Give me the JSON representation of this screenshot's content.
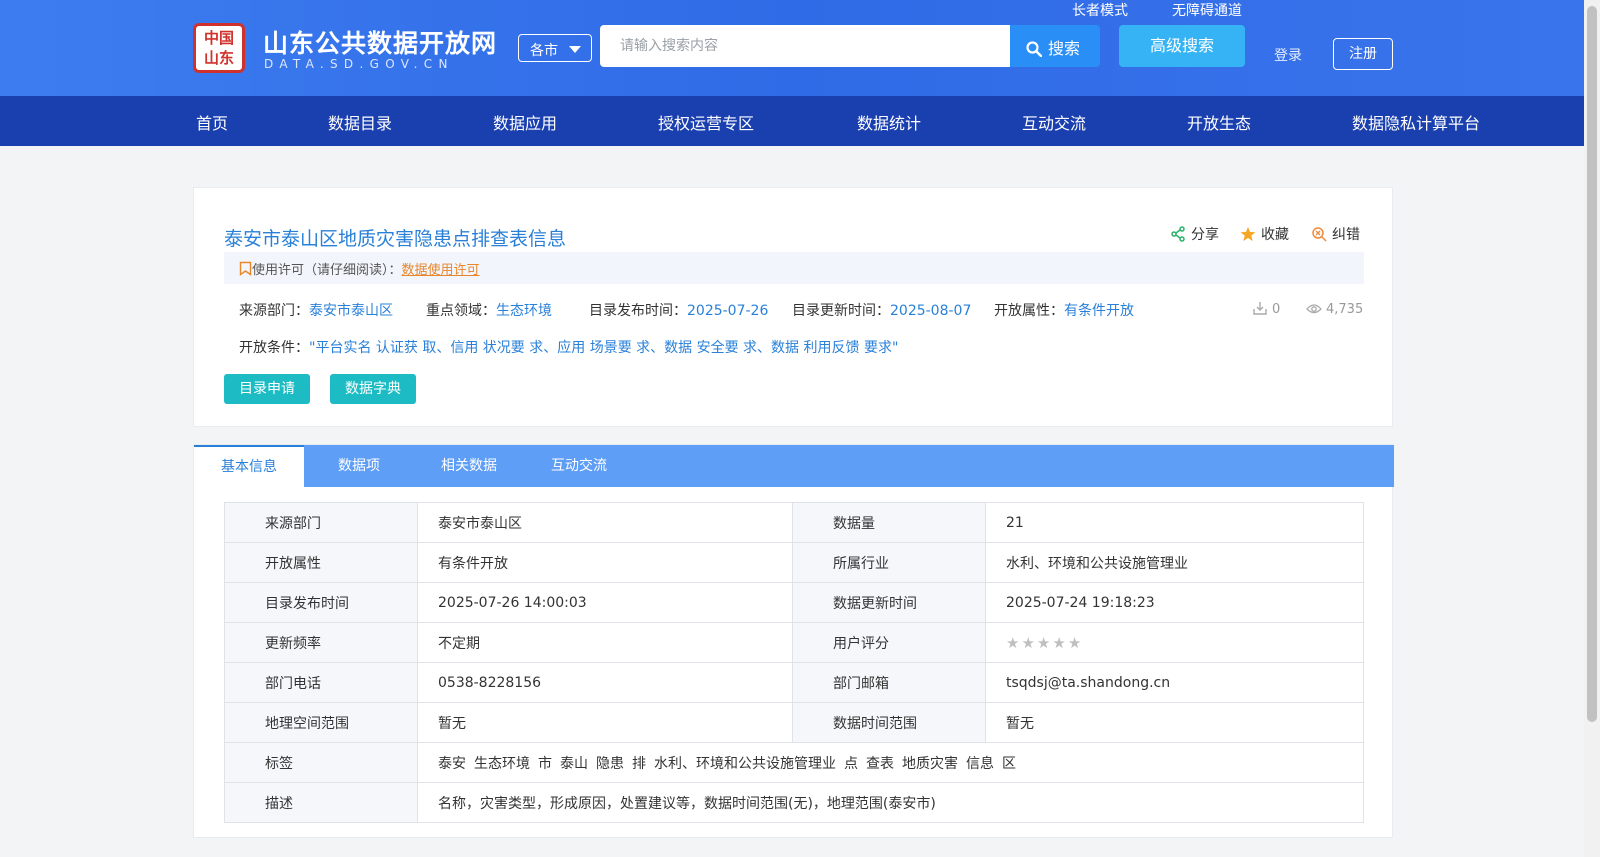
{
  "header": {
    "logo_seal_text": "中国山东",
    "logo_title": "山东公共数据开放网",
    "logo_subtitle": "DATA.SD.GOV.CN",
    "city_select": "各市",
    "search_placeholder": "请输入搜索内容",
    "search_button": "搜索",
    "advanced_search": "高级搜索",
    "elder_mode": "长者模式",
    "accessibility": "无障碍通道",
    "login": "登录",
    "register": "注册"
  },
  "nav": {
    "items": [
      "首页",
      "数据目录",
      "数据应用",
      "授权运营专区",
      "数据统计",
      "互动交流",
      "开放生态",
      "数据隐私计算平台"
    ]
  },
  "dataset": {
    "title": "泰安市泰山区地质灾害隐患点排查表信息",
    "actions": {
      "share": "分享",
      "favorite": "收藏",
      "report": "纠错"
    },
    "license_label": "使用许可（请仔细阅读）：",
    "license_link": "数据使用许可",
    "source_label": "来源部门：",
    "source_value": "泰安市泰山区",
    "domain_label": "重点领域：",
    "domain_value": "生态环境",
    "publish_label": "目录发布时间：",
    "publish_value": "2025-07-26",
    "update_label": "目录更新时间：",
    "update_value": "2025-08-07",
    "open_label": "开放属性：",
    "open_value": "有条件开放",
    "download_count": "0",
    "view_count": "4,735",
    "condition_label": "开放条件：",
    "condition_value": "\"平台实名 认证获 取、信用 状况要 求、应用 场景要 求、数据 安全要 求、数据 利用反馈 要求\"",
    "apply_button": "目录申请",
    "dictionary_button": "数据字典"
  },
  "tabs": [
    "基本信息",
    "数据项",
    "相关数据",
    "互动交流"
  ],
  "details": {
    "source_dept_k": "来源部门",
    "source_dept_v": "泰安市泰山区",
    "data_volume_k": "数据量",
    "data_volume_v": "21",
    "open_attr_k": "开放属性",
    "open_attr_v": "有条件开放",
    "industry_k": "所属行业",
    "industry_v": "水利、环境和公共设施管理业",
    "publish_time_k": "目录发布时间",
    "publish_time_v": "2025-07-26 14:00:03",
    "update_time_k": "数据更新时间",
    "update_time_v": "2025-07-24 19:18:23",
    "frequency_k": "更新频率",
    "frequency_v": "不定期",
    "rating_k": "用户评分",
    "rating_value": 0,
    "rating_max": 5,
    "phone_k": "部门电话",
    "phone_v": "0538-8228156",
    "email_k": "部门邮箱",
    "email_v": "tsqdsj@ta.shandong.cn",
    "geo_k": "地理空间范围",
    "geo_v": "暂无",
    "time_range_k": "数据时间范围",
    "time_range_v": "暂无",
    "tags_k": "标签",
    "tags": [
      "泰安",
      "生态环境",
      "市",
      "泰山",
      "隐患",
      "排",
      "水利、环境和公共设施管理业",
      "点",
      "查表",
      "地质灾害",
      "信息",
      "区"
    ],
    "desc_k": "描述",
    "desc_v": "名称，灾害类型，形成原因，处置建议等，数据时间范围(无)，地理范围(泰安市)"
  },
  "colors": {
    "header_blue": "#2f6be6",
    "nav_blue": "#1a3faf",
    "link_blue": "#2a80d8",
    "teal": "#1dbcc4",
    "orange": "#e8862c"
  }
}
